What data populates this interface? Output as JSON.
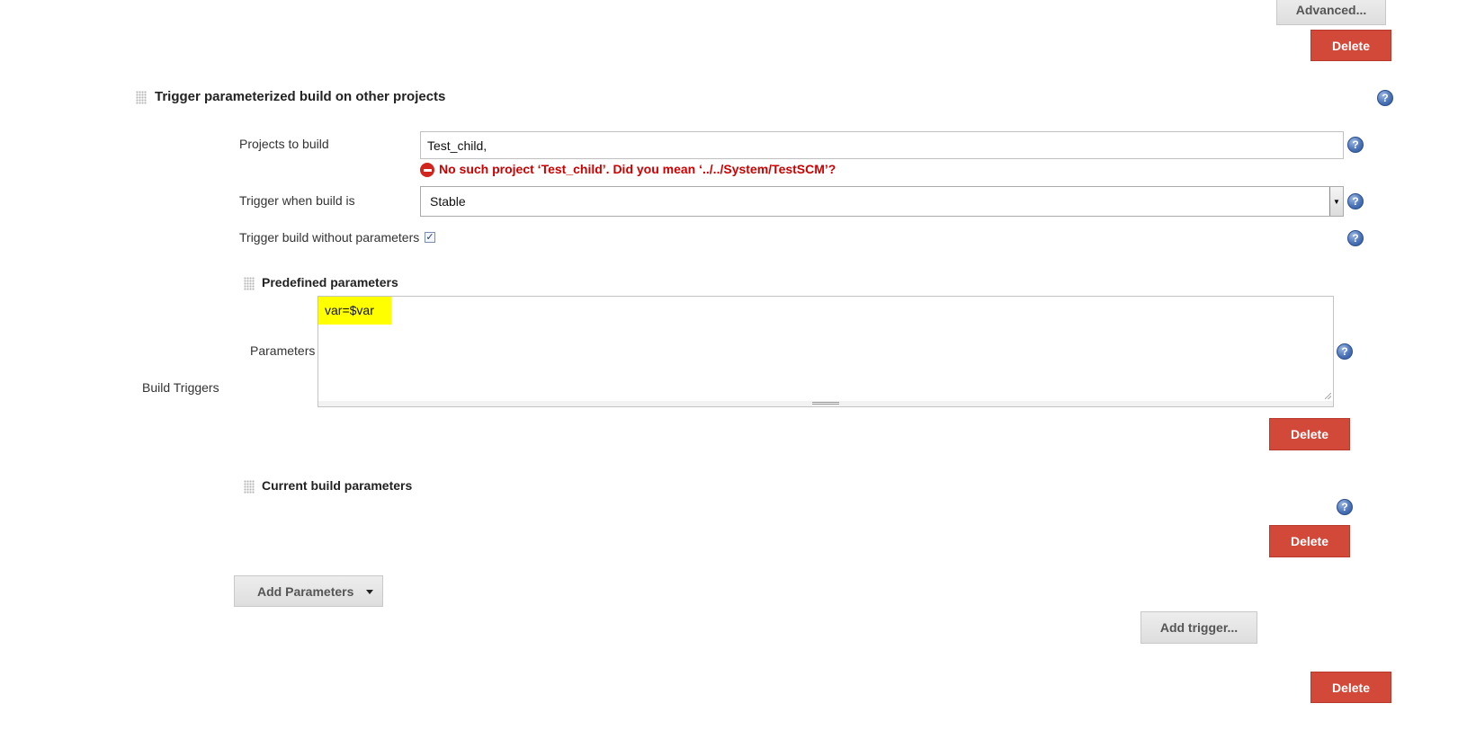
{
  "top_buttons": {
    "advanced_label": "Advanced...",
    "delete_label": "Delete"
  },
  "trigger_section": {
    "title": "Trigger parameterized build on other projects",
    "projects_to_build": {
      "label": "Projects to build",
      "value": "Test_child,",
      "error": "No such project ‘Test_child’. Did you mean ‘../../System/TestSCM’?"
    },
    "trigger_when": {
      "label": "Trigger when build is",
      "selected": "Stable"
    },
    "without_params": {
      "label": "Trigger build without parameters",
      "checked": true,
      "check_glyph": "✓"
    }
  },
  "predefined": {
    "title": "Predefined parameters",
    "parameters_label": "Parameters",
    "value": "var=$var",
    "delete_label": "Delete"
  },
  "current": {
    "title": "Current build parameters",
    "delete_label": "Delete"
  },
  "build_triggers_label": "Build Triggers",
  "add_parameters_label": "Add Parameters",
  "add_trigger_label": "Add trigger...",
  "bottom_delete_label": "Delete",
  "help_glyph": "?",
  "colors": {
    "delete_button": "#d24939",
    "error_text": "#cc0000",
    "highlight": "#ffff00",
    "help_icon": "#4c74b8"
  }
}
